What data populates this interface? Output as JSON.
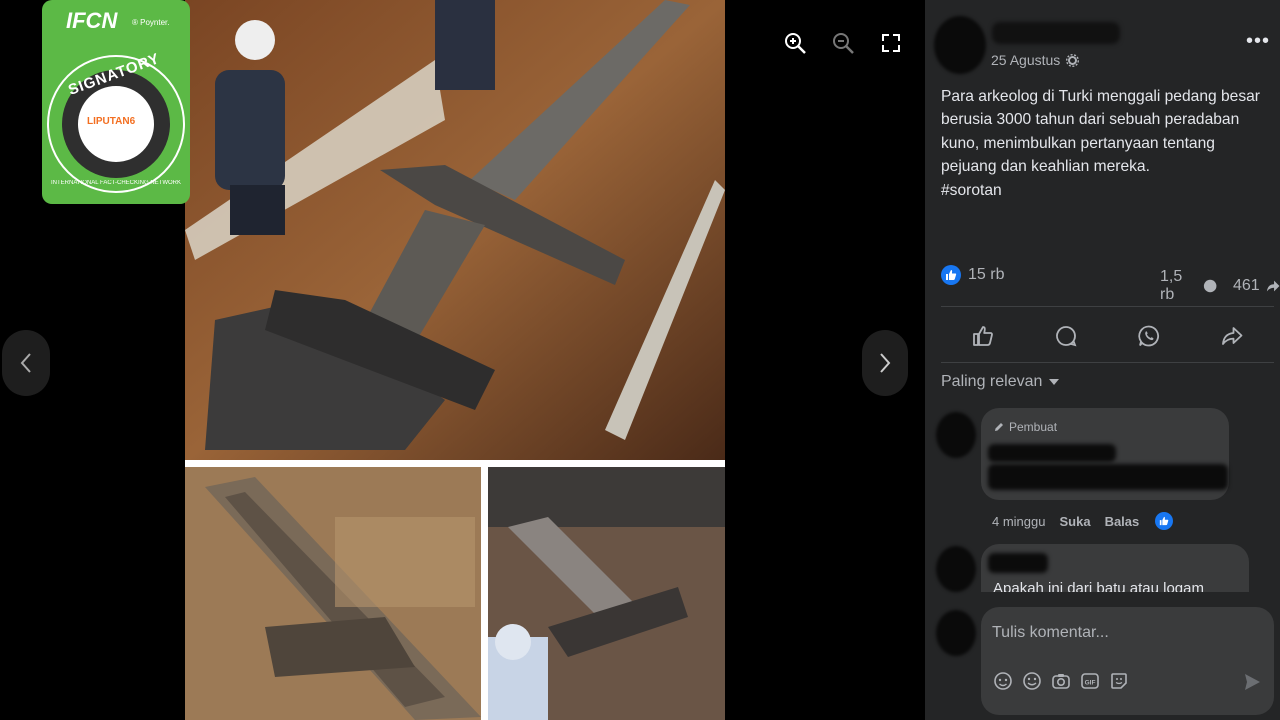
{
  "viewer": {
    "tools": [
      "zoom-in-icon",
      "zoom-out-icon",
      "fullscreen-icon"
    ],
    "badge": {
      "org": "IFCN",
      "sub": "® Poynter.",
      "word": "SIGNATORY",
      "ring_text": "INTERNATIONAL FACT-CHECKING NETWORK",
      "partner": "LIPUTAN6"
    }
  },
  "post": {
    "date": "25 Agustus",
    "text": "Para arkeolog di Turki menggali pedang besar berusia 3000 tahun dari sebuah peradaban kuno, menimbulkan pertanyaan tentang pejuang dan keahlian mereka.",
    "hashtag": "#sorotan",
    "likes": "15 rb",
    "comments_count": "1,5 rb",
    "shares_count": "461",
    "sort_label": "Paling relevan"
  },
  "comments": [
    {
      "author_tag": "Pembuat",
      "time": "4 minggu",
      "like_label": "Suka",
      "reply_label": "Balas"
    },
    {
      "text": "Apakah ini dari batu atau logam"
    }
  ],
  "composer": {
    "placeholder": "Tulis komentar..."
  },
  "colors": {
    "panel_bg": "#242526",
    "bubble_bg": "#3a3b3c",
    "accent_blue": "#1877f2",
    "ifcn_green": "#5cb946"
  }
}
